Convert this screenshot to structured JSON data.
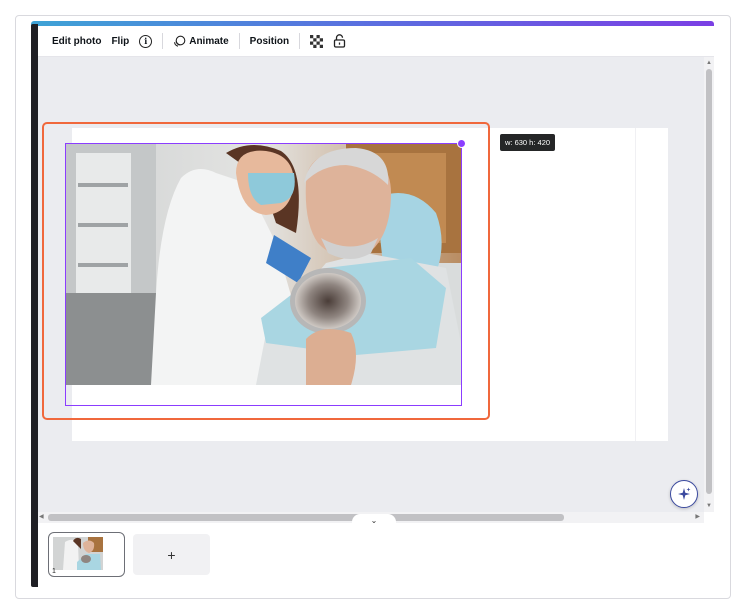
{
  "toolbar": {
    "edit_photo": "Edit photo",
    "flip": "Flip",
    "info_icon": "i",
    "animate": "Animate",
    "position": "Position"
  },
  "selection": {
    "size_tooltip": "w: 630 h: 420"
  },
  "pages": {
    "current_page_number": "1",
    "add_page_label": "+"
  },
  "icons": {
    "collapse": "‹",
    "pages_toggle": "⌄",
    "scroll_up": "▲",
    "scroll_down": "▼",
    "scroll_left": "◀",
    "scroll_right": "▶"
  },
  "colors": {
    "selection_orange": "#f0683c",
    "selection_purple": "#8b3dff",
    "rail_dark": "#1f1f24",
    "canvas_bg": "#ebecf0"
  }
}
